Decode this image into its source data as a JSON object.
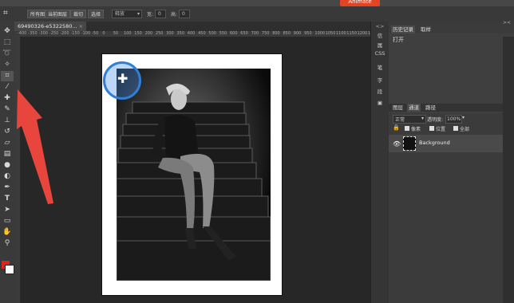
{
  "menubar": {
    "animate_label": "Animate"
  },
  "options": {
    "all_layers": "所有图层",
    "current_layer": "当前图层",
    "crop": "裁切",
    "select": "选择",
    "mode_value": "释放",
    "w_label": "宽:",
    "w_value": "0",
    "h_label": "高:",
    "h_value": "0"
  },
  "document": {
    "tab_title": "69490326-e5322580..."
  },
  "ruler": {
    "ticks": [
      "-400",
      "-350",
      "-300",
      "-250",
      "-200",
      "-150",
      "-100",
      "-50",
      "0",
      "50",
      "100",
      "150",
      "200",
      "250",
      "300",
      "350",
      "400",
      "450",
      "500",
      "550",
      "600",
      "650",
      "700",
      "750",
      "800",
      "850",
      "900",
      "950",
      "1000",
      "1050",
      "1100",
      "1150",
      "1200",
      "125"
    ]
  },
  "panel_strip": {
    "items": [
      "信",
      "属",
      "CSS",
      "笔",
      "字",
      "段"
    ]
  },
  "history": {
    "tabs": [
      "历史记录",
      "取样"
    ],
    "items": [
      "打开"
    ]
  },
  "layers": {
    "tabs": [
      "图层",
      "通道",
      "路径"
    ],
    "blend_mode": "正常",
    "opacity_label": "透明度:",
    "opacity_value": "100%",
    "lock_label": "",
    "lock_pixels": "像素",
    "lock_position": "位置",
    "lock_all": "全部",
    "layer_name": "Background"
  },
  "colors": {
    "accent": "#e34424",
    "highlight": "#2f7fd6",
    "arrow": "#e8453c"
  }
}
